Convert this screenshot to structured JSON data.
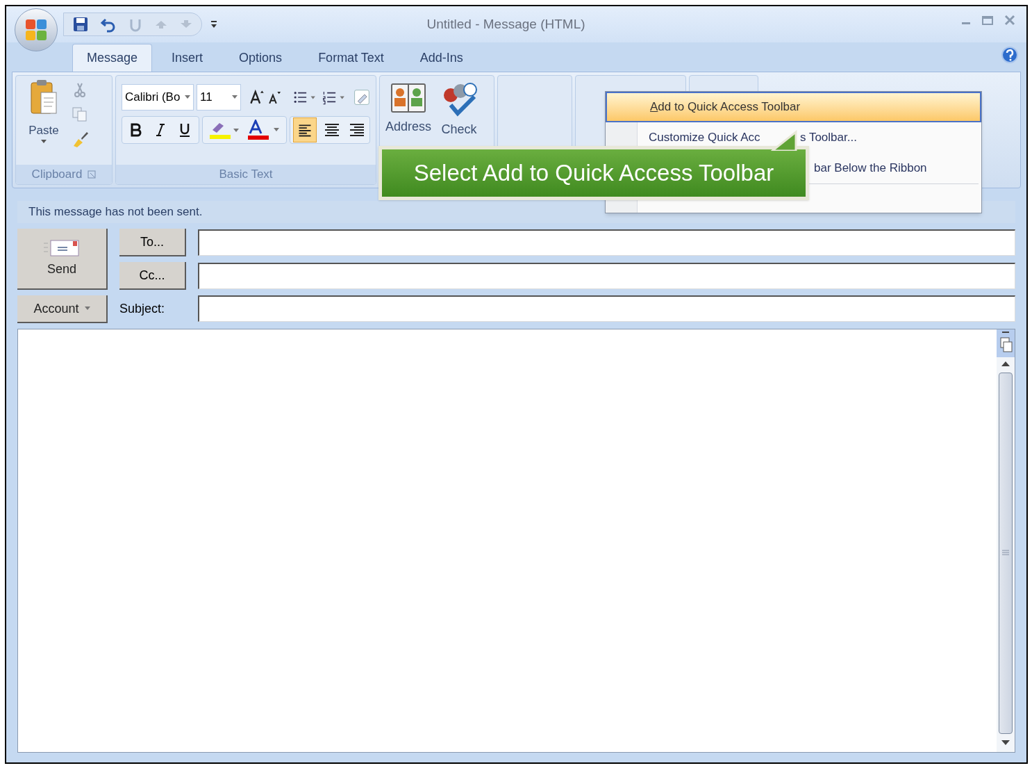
{
  "window": {
    "title": "Untitled - Message (HTML)"
  },
  "tabs": [
    {
      "label": "Message",
      "selected": true
    },
    {
      "label": "Insert",
      "selected": false
    },
    {
      "label": "Options",
      "selected": false
    },
    {
      "label": "Format Text",
      "selected": false
    },
    {
      "label": "Add-Ins",
      "selected": false
    }
  ],
  "ribbon": {
    "paste": "Paste",
    "clipboard_group": "Clipboard",
    "font_name": "Calibri (Bo",
    "font_size": "11",
    "basic_text_group": "Basic Text",
    "address": "Address",
    "check": "Check"
  },
  "context_menu": {
    "items": [
      {
        "kind": "full",
        "label": "Add to Quick Access Toolbar",
        "selected": true,
        "access_key_shown": true
      },
      {
        "kind": "split",
        "label": "Customize Quick Acc",
        "label_after": "s Toolbar...",
        "selected": false,
        "access_key_shown": false
      },
      {
        "kind": "tail",
        "label": "bar Below the Ribbon",
        "selected": false,
        "access_key_shown": false
      }
    ]
  },
  "callout": {
    "text": "Select Add to Quick Access Toolbar"
  },
  "message_bar": "This message has not been sent.",
  "compose": {
    "send": "Send",
    "to": "To...",
    "cc": "Cc...",
    "account": "Account",
    "subject_label": "Subject:"
  }
}
